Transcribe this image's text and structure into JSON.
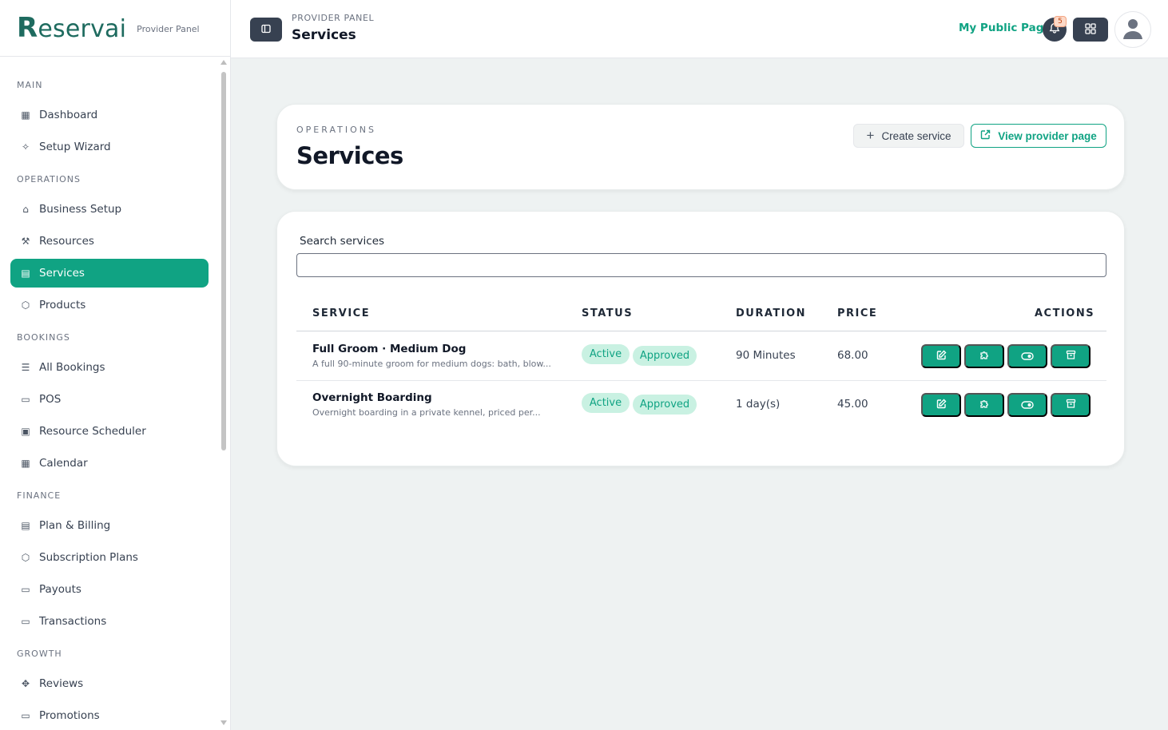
{
  "brand": {
    "logo_r": "R",
    "logo_rest": "eservai",
    "subtitle": "Provider Panel"
  },
  "nav": {
    "sections": [
      {
        "label": "MAIN",
        "items": [
          {
            "label": "Dashboard",
            "icon": "grid-icon"
          },
          {
            "label": "Setup Wizard",
            "icon": "wand-icon"
          }
        ]
      },
      {
        "label": "OPERATIONS",
        "items": [
          {
            "label": "Business Setup",
            "icon": "store-icon"
          },
          {
            "label": "Resources",
            "icon": "wrench-icon"
          },
          {
            "label": "Services",
            "icon": "briefcase-icon",
            "active": true
          },
          {
            "label": "Products",
            "icon": "box-icon"
          }
        ]
      },
      {
        "label": "BOOKINGS",
        "items": [
          {
            "label": "All Bookings",
            "icon": "list-icon"
          },
          {
            "label": "POS",
            "icon": "card-icon"
          },
          {
            "label": "Resource Scheduler",
            "icon": "calendar-icon"
          },
          {
            "label": "Calendar",
            "icon": "calendar-grid-icon"
          }
        ]
      },
      {
        "label": "FINANCE",
        "items": [
          {
            "label": "Plan & Billing",
            "icon": "receipt-icon"
          },
          {
            "label": "Subscription Plans",
            "icon": "cube-icon"
          },
          {
            "label": "Payouts",
            "icon": "wallet-icon"
          },
          {
            "label": "Transactions",
            "icon": "credit-card-icon"
          }
        ]
      },
      {
        "label": "GROWTH",
        "items": [
          {
            "label": "Reviews",
            "icon": "network-icon"
          },
          {
            "label": "Promotions",
            "icon": "ticket-icon"
          }
        ]
      }
    ]
  },
  "topbar": {
    "breadcrumb": "PROVIDER PANEL",
    "title": "Services",
    "public_link": "My Public Page",
    "notification_count": "5"
  },
  "header": {
    "eyebrow": "OPERATIONS",
    "title": "Services",
    "create_label": "Create service",
    "view_label": "View provider page"
  },
  "search": {
    "label": "Search services",
    "value": "",
    "placeholder": ""
  },
  "table": {
    "columns": [
      "SERVICE",
      "STATUS",
      "DURATION",
      "PRICE",
      "ACTIONS"
    ],
    "rows": [
      {
        "name": "Full Groom · Medium Dog",
        "description": "A full 90-minute groom for medium dogs: bath, blow...",
        "status": "Active",
        "approval": "Approved",
        "duration": "90 Minutes",
        "price": "68.00"
      },
      {
        "name": "Overnight Boarding",
        "description": "Overnight boarding in a private kennel, priced per...",
        "status": "Active",
        "approval": "Approved",
        "duration": "1 day(s)",
        "price": "45.00"
      }
    ]
  },
  "colors": {
    "accent": "#10a383",
    "brand": "#1e6b5f",
    "dark_button": "#374151",
    "pill_bg": "#c9f1e2"
  }
}
